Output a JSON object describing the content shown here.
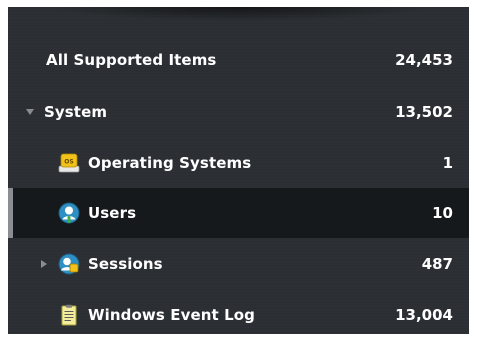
{
  "tree": {
    "items": [
      {
        "label": "All Supported Items",
        "count": "24,453"
      },
      {
        "label": "System",
        "count": "13,502",
        "toggle": "expanded"
      },
      {
        "label": "Operating Systems",
        "count": "1",
        "icon": "operating-systems-icon"
      },
      {
        "label": "Users",
        "count": "10",
        "icon": "user-icon",
        "selected": true
      },
      {
        "label": "Sessions",
        "count": "487",
        "icon": "sessions-icon",
        "toggle": "collapsed"
      },
      {
        "label": "Windows Event Log",
        "count": "13,004",
        "icon": "event-log-icon"
      }
    ]
  },
  "colors": {
    "panel_bg": "#2b2f33",
    "selected_bg": "#16191b",
    "selection_marker": "#8a8e92",
    "text": "#ffffff",
    "toggle": "#8a8e92"
  }
}
